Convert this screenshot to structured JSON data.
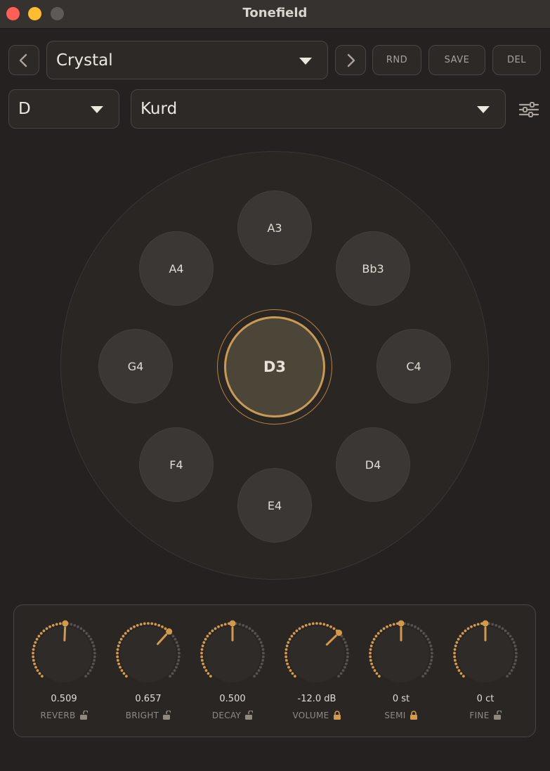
{
  "window": {
    "title": "Tonefield"
  },
  "toolbar": {
    "preset": "Crystal",
    "rnd_label": "RND",
    "save_label": "SAVE",
    "del_label": "DEL",
    "key": "D",
    "scale": "Kurd"
  },
  "notes": {
    "center": "D3",
    "top": "A3",
    "upper_right": "Bb3",
    "right": "C4",
    "lower_right": "D4",
    "bottom": "E4",
    "lower_left": "F4",
    "left": "G4",
    "upper_left": "A4"
  },
  "knobs": [
    {
      "label": "REVERB",
      "value": "0.509",
      "level": 0.509,
      "locked": false
    },
    {
      "label": "BRIGHT",
      "value": "0.657",
      "level": 0.657,
      "locked": false
    },
    {
      "label": "DECAY",
      "value": "0.500",
      "level": 0.5,
      "locked": false
    },
    {
      "label": "VOLUME",
      "value": "-12.0 dB",
      "level": 0.67,
      "locked": true
    },
    {
      "label": "SEMI",
      "value": "0 st",
      "level": 0.5,
      "locked": true
    },
    {
      "label": "FINE",
      "value": "0 ct",
      "level": 0.5,
      "locked": false
    }
  ],
  "colors": {
    "accent": "#d39a4a",
    "lock_active": "#d39a4a",
    "lock_inactive": "#8f8982"
  }
}
